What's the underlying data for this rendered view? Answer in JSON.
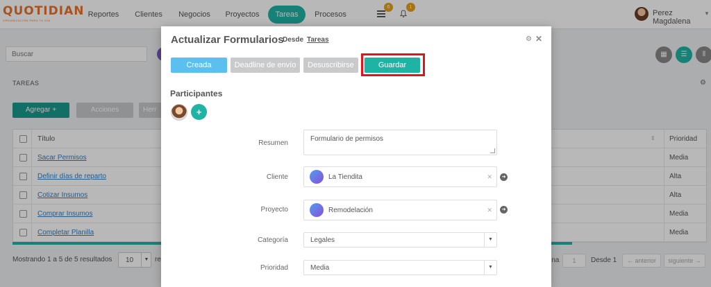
{
  "app": {
    "logo_text": "QUOTIDIAN",
    "logo_tagline": "ORGANIZACIÓN PARA TU DÍA",
    "nav": [
      {
        "label": "Reportes"
      },
      {
        "label": "Clientes"
      },
      {
        "label": "Negocios"
      },
      {
        "label": "Proyectos"
      },
      {
        "label": "Tareas"
      },
      {
        "label": "Procesos"
      }
    ],
    "active_nav": "Tareas",
    "notifications": {
      "list_count": "6",
      "bell_count": "1"
    },
    "user_name": "Perez Magdalena"
  },
  "toolbar": {
    "search_placeholder": "Buscar"
  },
  "panel": {
    "title": "TAREAS",
    "add_label": "Agregar +",
    "actions_label": "Acciones",
    "tools_label": "Herr"
  },
  "table": {
    "col_title": "Título",
    "col_priority": "Prioridad",
    "rows": [
      {
        "title": "Sacar Permisos",
        "priority": "Media"
      },
      {
        "title": "Definir días de reparto",
        "priority": "Alta"
      },
      {
        "title": "Cotizar Insumos",
        "priority": "Alta"
      },
      {
        "title": "Comprar Insumos",
        "priority": "Media"
      },
      {
        "title": "Completar Planilla",
        "priority": "Media"
      }
    ]
  },
  "footer": {
    "showing": "Mostrando 1 a 5 de 5 resultados",
    "page_size": "10",
    "page_size_after": "re",
    "page_label": "ina",
    "page_value": "1",
    "of_label": "Desde  1",
    "prev": "← anterior",
    "next": "siguiente →"
  },
  "modal": {
    "title": "Actualizar Formularios",
    "from_label": "Desde",
    "from_link": "Tareas",
    "stages": [
      "Creada",
      "Deadline de envío",
      "Desuscribirse",
      "Guardar"
    ],
    "participants_label": "Participantes",
    "add_participant": "+",
    "fields": {
      "summary": {
        "label": "Resumen",
        "value": "Formulario de permisos"
      },
      "client": {
        "label": "Cliente",
        "value": "La Tiendita"
      },
      "project": {
        "label": "Proyecto",
        "value": "Remodelación"
      },
      "category": {
        "label": "Categoría",
        "value": "Legales"
      },
      "priority": {
        "label": "Prioridad",
        "value": "Media"
      }
    }
  },
  "colors": {
    "teal": "#1fb3a5",
    "sky": "#5bc0f0",
    "grey_button": "#c8cacc",
    "highlight_red": "#e0151b",
    "brand_orange": "#e8722c"
  }
}
